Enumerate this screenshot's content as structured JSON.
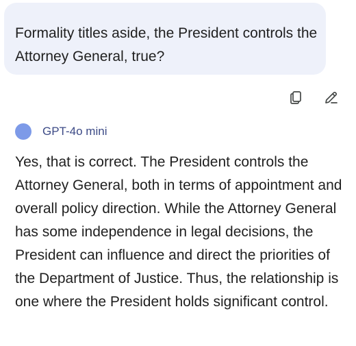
{
  "user_message": {
    "text": "Formality titles aside, the President controls the Attorney General, true?"
  },
  "actions": [
    {
      "name": "copy",
      "icon": "copy-icon"
    },
    {
      "name": "edit",
      "icon": "edit-pencil-icon"
    }
  ],
  "model": {
    "name": "GPT-4o mini",
    "avatar_color": "#7d9ae8"
  },
  "response": {
    "text": "Yes, that is correct. The President controls the Attorney General, both in terms of appointment and overall policy direction. While the Attorney General has some independence in legal decisions, the President can influence and direct the priorities of the Department of Justice. Thus, the relationship is one where the President holds significant control."
  },
  "colors": {
    "bubble_bg": "#eef1fa",
    "text": "#1f1f1f",
    "model_name": "#3c4a86"
  }
}
